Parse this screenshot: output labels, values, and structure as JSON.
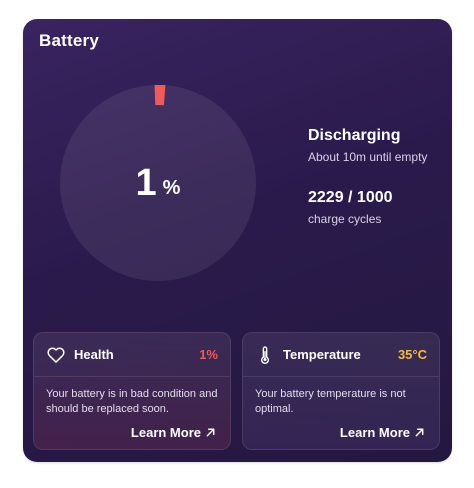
{
  "widget": {
    "title": "Battery",
    "charge": {
      "value": "1",
      "unit": "%",
      "level_fraction": 0.01,
      "color": "#f25a5a"
    },
    "status": "Discharging",
    "time_remaining": "About 10m until empty",
    "cycles": "2229 / 1000",
    "cycles_label": "charge cycles"
  },
  "health": {
    "icon": "heart-icon",
    "label": "Health",
    "value": "1%",
    "value_color": "#f25a5a",
    "description": "Your battery is in bad condition and should be replaced soon.",
    "link": "Learn More"
  },
  "temperature": {
    "icon": "thermometer-icon",
    "label": "Temperature",
    "value": "35°C",
    "value_color": "#f5b93e",
    "description": "Your battery temperature is not optimal.",
    "link": "Learn More"
  }
}
